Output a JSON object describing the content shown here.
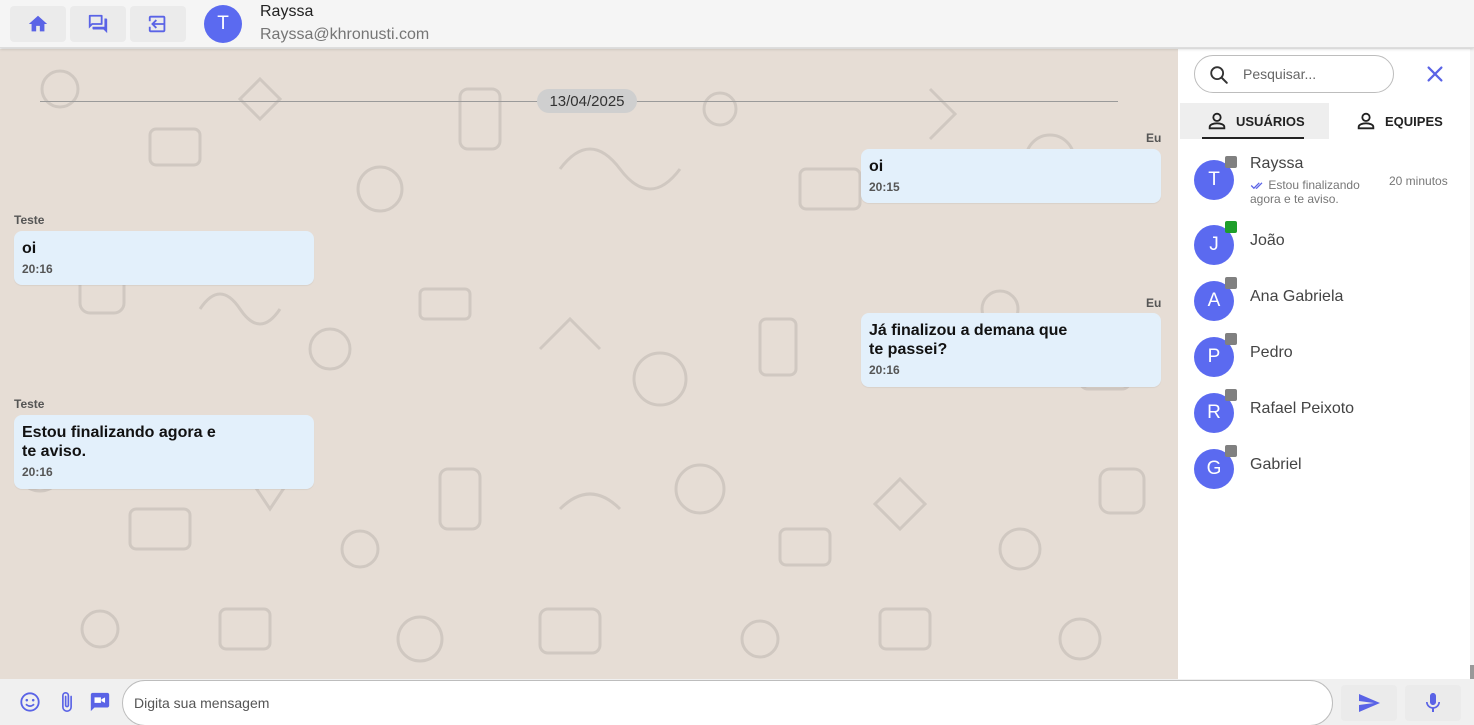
{
  "header": {
    "avatar_letter": "T",
    "user_name": "Rayssa",
    "user_email": "Rayssa@khronusti.com",
    "nav": [
      {
        "icon": "home-icon"
      },
      {
        "icon": "chat-icon"
      },
      {
        "icon": "logout-icon"
      }
    ]
  },
  "chat": {
    "date": "13/04/2025",
    "messages": [
      {
        "sender": "Eu",
        "text": "oi",
        "time": "20:15",
        "side": "right"
      },
      {
        "sender": "Teste",
        "text": "oi",
        "time": "20:16",
        "side": "left"
      },
      {
        "sender": "Eu",
        "text": "Já finalizou a demana que te passei?",
        "time": "20:16",
        "side": "right"
      },
      {
        "sender": "Teste",
        "text": "Estou finalizando agora e te aviso.",
        "time": "20:16",
        "side": "left"
      }
    ]
  },
  "panel": {
    "search_placeholder": "Pesquisar...",
    "tabs": [
      {
        "label": "USUÁRIOS",
        "active": true
      },
      {
        "label": "EQUIPES",
        "active": false
      }
    ],
    "users": [
      {
        "letter": "T",
        "name": "Rayssa",
        "status": "offline",
        "preview": "Estou finalizando agora e te aviso.",
        "time": "20 minutos"
      },
      {
        "letter": "J",
        "name": "João",
        "status": "online"
      },
      {
        "letter": "A",
        "name": "Ana Gabriela",
        "status": "offline"
      },
      {
        "letter": "P",
        "name": "Pedro",
        "status": "offline"
      },
      {
        "letter": "R",
        "name": "Rafael Peixoto",
        "status": "offline"
      },
      {
        "letter": "G",
        "name": "Gabriel",
        "status": "offline"
      }
    ]
  },
  "composer": {
    "placeholder": "Digita sua mensagem"
  },
  "colors": {
    "accent": "#5a63e6",
    "avatar": "#5b6af0",
    "chat_background": "#e6ddd5",
    "bubble": "#e3f0fb",
    "online": "#1e9e2a",
    "offline": "#808080"
  }
}
